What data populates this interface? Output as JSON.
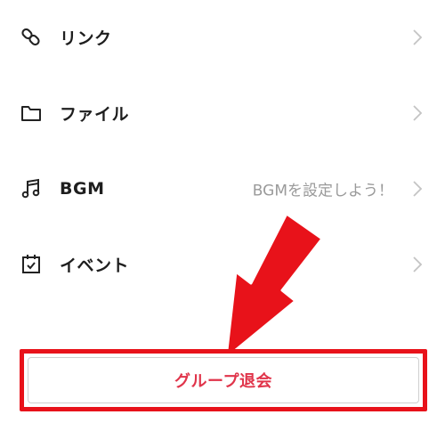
{
  "menu": {
    "link": {
      "label": "リンク",
      "icon": "link-icon"
    },
    "file": {
      "label": "ファイル",
      "icon": "folder-icon"
    },
    "bgm": {
      "label": "BGM",
      "value": "BGMを設定しよう！",
      "icon": "music-note-icon"
    },
    "event": {
      "label": "イベント",
      "icon": "calendar-check-icon"
    }
  },
  "leave_group": {
    "label": "グループ退会"
  },
  "colors": {
    "accent_red": "#e8121a",
    "leave_text": "#e0344a",
    "chevron": "#c4c4c4",
    "value_text": "#9a9a9a"
  }
}
